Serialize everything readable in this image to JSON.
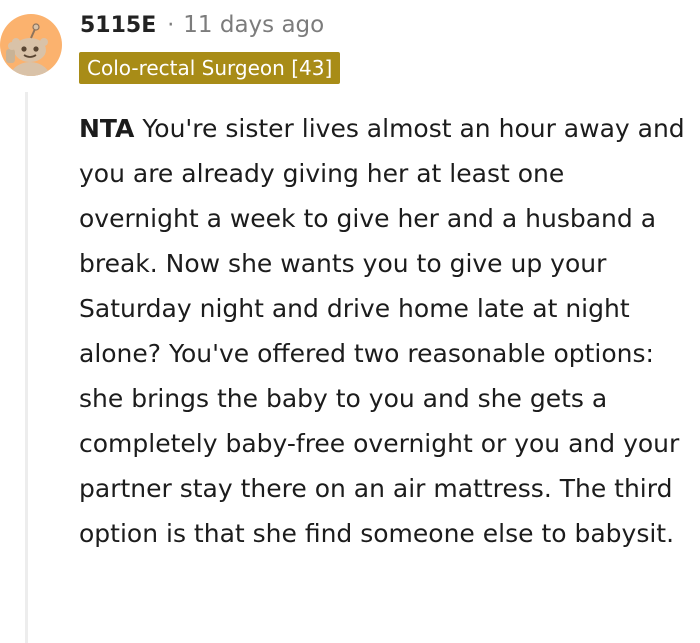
{
  "comment": {
    "author": "5115E",
    "separator": "·",
    "timestamp": "11 days ago",
    "flair": "Colo-rectal Surgeon [43]",
    "avatar_icon": "snoo-avatar-icon",
    "body_lead": "NTA",
    "body_text": " You're sister lives almost an hour away and you are already giving her at least one overnight a week to give her and a husband a break. Now she wants you to give up your Saturday night and drive home late at night alone? You've offered two reasonable options: she brings the baby to you and she gets a completely baby-free overnight or you and your partner stay there on an air mattress. The third option is that she find someone else to babysit."
  },
  "colors": {
    "avatar_bg": "#fbb26e",
    "flair_bg": "#a88c17",
    "thread_line": "#ededed",
    "meta_text": "#7c7c7c"
  }
}
